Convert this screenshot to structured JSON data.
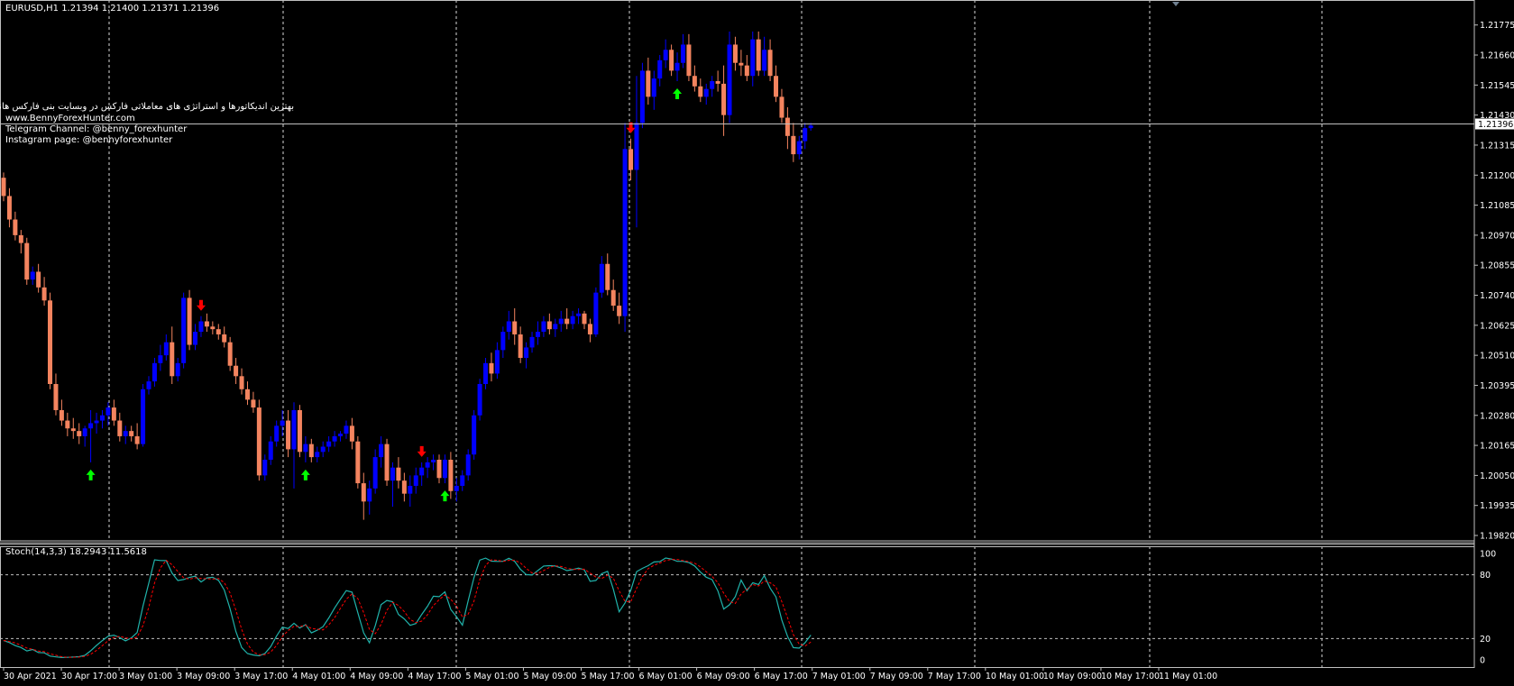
{
  "window": {
    "symbol_line": "EURUSD,H1  1.21394 1.21400 1.21371 1.21396"
  },
  "promo": {
    "line1": "بهترین اندیکاتورها و استراتژی های معاملاتی فارکس در وبسایت بنی فارکس هانتر",
    "line2": "www.BennyForexHunter.com",
    "line3": "Telegram Channel: @benny_forexhunter",
    "line4": "Instagram page: @bennyforexhunter"
  },
  "colors": {
    "background": "#000000",
    "bull": "#0000ff",
    "bear": "#f4845f",
    "grid": "#ffffff",
    "up_arrow": "#00ff00",
    "down_arrow": "#ff0000",
    "stoch_main": "#20b2aa",
    "stoch_signal": "#ff0000",
    "price_line": "#c0c0c0"
  },
  "price_axis": {
    "ticks": [
      "1.21775",
      "1.21660",
      "1.21545",
      "1.21430",
      "1.21315",
      "1.21200",
      "1.21085",
      "1.20970",
      "1.20855",
      "1.20740",
      "1.20625",
      "1.20510",
      "1.20395",
      "1.20280",
      "1.20165",
      "1.20050",
      "1.19935",
      "1.19820"
    ],
    "current_price": "1.21396"
  },
  "time_axis": {
    "labels": [
      "30 Apr 2021",
      "30 Apr 17:00",
      "3 May 01:00",
      "3 May 09:00",
      "3 May 17:00",
      "4 May 01:00",
      "4 May 09:00",
      "4 May 17:00",
      "5 May 01:00",
      "5 May 09:00",
      "5 May 17:00",
      "6 May 01:00",
      "6 May 09:00",
      "6 May 17:00",
      "7 May 01:00",
      "7 May 09:00",
      "7 May 17:00",
      "10 May 01:00",
      "10 May 09:00",
      "10 May 17:00",
      "11 May 01:00"
    ]
  },
  "stoch": {
    "label": "Stoch(14,3,3) 18.2943 11.5618",
    "levels": [
      "100",
      "80",
      "20",
      "0"
    ]
  },
  "chart_data": {
    "type": "candlestick",
    "symbol": "EURUSD",
    "timeframe": "H1",
    "ylim": [
      1.1982,
      1.2185
    ],
    "candles_ohlc_approx": [
      [
        1.2119,
        1.2121,
        1.211,
        1.2112
      ],
      [
        1.2112,
        1.2115,
        1.21,
        1.2103
      ],
      [
        1.2103,
        1.2106,
        1.2095,
        1.2097
      ],
      [
        1.2097,
        1.2099,
        1.209,
        1.2094
      ],
      [
        1.2094,
        1.2096,
        1.2078,
        1.208
      ],
      [
        1.208,
        1.2085,
        1.2078,
        1.2083
      ],
      [
        1.2083,
        1.2086,
        1.2075,
        1.2077
      ],
      [
        1.2077,
        1.2081,
        1.207,
        1.2072
      ],
      [
        1.2072,
        1.2075,
        1.2038,
        1.204
      ],
      [
        1.204,
        1.2044,
        1.2028,
        1.203
      ],
      [
        1.203,
        1.2034,
        1.2024,
        1.2026
      ],
      [
        1.2026,
        1.2029,
        1.202,
        1.2023
      ],
      [
        1.2023,
        1.2027,
        1.2019,
        1.2022
      ],
      [
        1.2022,
        1.2025,
        1.2017,
        1.202
      ],
      [
        1.202,
        1.2024,
        1.2016,
        1.2023
      ],
      [
        1.2023,
        1.203,
        1.201,
        1.2025
      ],
      [
        1.2025,
        1.2029,
        1.2021,
        1.2026
      ],
      [
        1.2026,
        1.203,
        1.2023,
        1.2028
      ],
      [
        1.2028,
        1.2033,
        1.2024,
        1.2031
      ],
      [
        1.2031,
        1.2034,
        1.2024,
        1.2026
      ],
      [
        1.2026,
        1.2029,
        1.2018,
        1.202
      ],
      [
        1.202,
        1.2024,
        1.2017,
        1.2022
      ],
      [
        1.2022,
        1.2024,
        1.2018,
        1.202
      ],
      [
        1.202,
        1.2025,
        1.2015,
        1.2017
      ],
      [
        1.2017,
        1.204,
        1.2016,
        1.2038
      ],
      [
        1.2038,
        1.2043,
        1.2036,
        1.2041
      ],
      [
        1.2041,
        1.205,
        1.2039,
        1.2048
      ],
      [
        1.2048,
        1.2055,
        1.2045,
        1.2051
      ],
      [
        1.2051,
        1.2059,
        1.2049,
        1.2056
      ],
      [
        1.2056,
        1.2062,
        1.204,
        1.2043
      ],
      [
        1.2043,
        1.205,
        1.2041,
        1.2048
      ],
      [
        1.2048,
        1.2075,
        1.2046,
        1.2073
      ],
      [
        1.2073,
        1.2076,
        1.2053,
        1.2055
      ],
      [
        1.2055,
        1.2063,
        1.2053,
        1.206
      ],
      [
        1.206,
        1.2066,
        1.2058,
        1.2064
      ],
      [
        1.2064,
        1.2067,
        1.206,
        1.2062
      ],
      [
        1.2062,
        1.2064,
        1.2059,
        1.2061
      ],
      [
        1.2061,
        1.2063,
        1.2057,
        1.2059
      ],
      [
        1.2059,
        1.2062,
        1.2054,
        1.2056
      ],
      [
        1.2056,
        1.2058,
        1.2045,
        1.2047
      ],
      [
        1.2047,
        1.205,
        1.204,
        1.2043
      ],
      [
        1.2043,
        1.2046,
        1.2036,
        1.2038
      ],
      [
        1.2038,
        1.2041,
        1.2032,
        1.2034
      ],
      [
        1.2034,
        1.2037,
        1.2029,
        1.2031
      ],
      [
        1.2031,
        1.2034,
        1.2003,
        1.2005
      ],
      [
        1.2005,
        1.2013,
        1.2003,
        1.2011
      ],
      [
        1.2011,
        1.202,
        1.2009,
        1.2018
      ],
      [
        1.2018,
        1.2026,
        1.2016,
        1.2024
      ],
      [
        1.2024,
        1.203,
        1.202,
        1.2026
      ],
      [
        1.2026,
        1.203,
        1.2012,
        1.2015
      ],
      [
        1.2015,
        1.2033,
        1.2,
        1.203
      ],
      [
        1.203,
        1.2032,
        1.2012,
        1.2014
      ],
      [
        1.2014,
        1.202,
        1.201,
        1.2017
      ],
      [
        1.2017,
        1.2019,
        1.201,
        1.2012
      ],
      [
        1.2012,
        1.2016,
        1.201,
        1.2014
      ],
      [
        1.2014,
        1.2018,
        1.2012,
        1.2016
      ],
      [
        1.2016,
        1.202,
        1.2014,
        1.2018
      ],
      [
        1.2018,
        1.2022,
        1.2016,
        1.202
      ],
      [
        1.202,
        1.2022,
        1.2018,
        1.2021
      ],
      [
        1.2021,
        1.2026,
        1.2019,
        1.2024
      ],
      [
        1.2024,
        1.2027,
        1.2015,
        1.2018
      ],
      [
        1.2018,
        1.202,
        1.2,
        1.2002
      ],
      [
        1.2002,
        1.2006,
        1.1988,
        1.1995
      ],
      [
        1.1995,
        1.2003,
        1.199,
        1.2
      ],
      [
        1.2,
        1.2015,
        1.1998,
        1.2012
      ],
      [
        1.2012,
        1.202,
        1.2008,
        1.2017
      ],
      [
        1.2017,
        1.2019,
        1.2001,
        1.2003
      ],
      [
        1.2003,
        1.201,
        1.1993,
        1.2008
      ],
      [
        1.2008,
        1.2012,
        1.2,
        1.2003
      ],
      [
        1.2003,
        1.2006,
        1.1995,
        1.1998
      ],
      [
        1.1998,
        1.2005,
        1.1993,
        1.2001
      ],
      [
        1.2001,
        1.2008,
        1.1998,
        1.2005
      ],
      [
        1.2005,
        1.201,
        1.2001,
        1.2008
      ],
      [
        1.2008,
        1.2012,
        1.2004,
        1.201
      ],
      [
        1.201,
        1.2013,
        1.2007,
        1.2011
      ],
      [
        1.2011,
        1.2013,
        1.2002,
        1.2004
      ],
      [
        1.2004,
        1.2013,
        1.2002,
        1.2011
      ],
      [
        1.2011,
        1.2014,
        1.1996,
        1.1999
      ],
      [
        1.1999,
        1.2004,
        1.1995,
        1.2001
      ],
      [
        1.2001,
        1.2007,
        1.1999,
        1.2005
      ],
      [
        1.2005,
        1.2015,
        1.2003,
        1.2013
      ],
      [
        1.2013,
        1.203,
        1.2011,
        1.2028
      ],
      [
        1.2028,
        1.2042,
        1.2026,
        1.204
      ],
      [
        1.204,
        1.205,
        1.2038,
        1.2048
      ],
      [
        1.2048,
        1.2052,
        1.2041,
        1.2044
      ],
      [
        1.2044,
        1.2056,
        1.2042,
        1.2053
      ],
      [
        1.2053,
        1.2062,
        1.205,
        1.206
      ],
      [
        1.206,
        1.2068,
        1.2057,
        1.2064
      ],
      [
        1.2064,
        1.2069,
        1.2055,
        1.2059
      ],
      [
        1.2059,
        1.2062,
        1.2048,
        1.205
      ],
      [
        1.205,
        1.2056,
        1.2046,
        1.2054
      ],
      [
        1.2054,
        1.206,
        1.2052,
        1.2058
      ],
      [
        1.2058,
        1.2064,
        1.2055,
        1.206
      ],
      [
        1.206,
        1.2066,
        1.2058,
        1.2064
      ],
      [
        1.2064,
        1.2067,
        1.2059,
        1.2061
      ],
      [
        1.2061,
        1.2065,
        1.2058,
        1.2063
      ],
      [
        1.2063,
        1.2068,
        1.206,
        1.2065
      ],
      [
        1.2065,
        1.2069,
        1.2061,
        1.2063
      ],
      [
        1.2063,
        1.2068,
        1.2061,
        1.2066
      ],
      [
        1.2066,
        1.2069,
        1.2063,
        1.2067
      ],
      [
        1.2067,
        1.2068,
        1.2061,
        1.2063
      ],
      [
        1.2063,
        1.2065,
        1.2056,
        1.2059
      ],
      [
        1.2059,
        1.2077,
        1.2058,
        1.2075
      ],
      [
        1.2075,
        1.2089,
        1.2073,
        1.2086
      ],
      [
        1.2086,
        1.209,
        1.2074,
        1.2076
      ],
      [
        1.2076,
        1.208,
        1.2068,
        1.207
      ],
      [
        1.207,
        1.2075,
        1.2063,
        1.2066
      ],
      [
        1.2066,
        1.214,
        1.206,
        1.213
      ],
      [
        1.213,
        1.2134,
        1.2118,
        1.2122
      ],
      [
        1.2122,
        1.2158,
        1.21,
        1.214
      ],
      [
        1.214,
        1.2163,
        1.2138,
        1.216
      ],
      [
        1.216,
        1.2165,
        1.2147,
        1.215
      ],
      [
        1.215,
        1.216,
        1.2145,
        1.2157
      ],
      [
        1.2157,
        1.2166,
        1.2154,
        1.2164
      ],
      [
        1.2164,
        1.2172,
        1.2161,
        1.2168
      ],
      [
        1.2168,
        1.217,
        1.2158,
        1.216
      ],
      [
        1.216,
        1.2167,
        1.2156,
        1.2163
      ],
      [
        1.2163,
        1.2174,
        1.2161,
        1.217
      ],
      [
        1.217,
        1.2174,
        1.2156,
        1.2158
      ],
      [
        1.2158,
        1.2162,
        1.2152,
        1.2154
      ],
      [
        1.2154,
        1.2157,
        1.2148,
        1.215
      ],
      [
        1.215,
        1.2155,
        1.2147,
        1.2153
      ],
      [
        1.2153,
        1.2158,
        1.215,
        1.2156
      ],
      [
        1.2156,
        1.216,
        1.2152,
        1.2155
      ],
      [
        1.2155,
        1.2162,
        1.2135,
        1.2143
      ],
      [
        1.2143,
        1.2175,
        1.214,
        1.217
      ],
      [
        1.217,
        1.2173,
        1.216,
        1.2163
      ],
      [
        1.2163,
        1.2168,
        1.2158,
        1.2162
      ],
      [
        1.2162,
        1.2166,
        1.2156,
        1.2158
      ],
      [
        1.2158,
        1.2175,
        1.2154,
        1.2172
      ],
      [
        1.2172,
        1.2175,
        1.2158,
        1.216
      ],
      [
        1.216,
        1.2173,
        1.2158,
        1.2168
      ],
      [
        1.2168,
        1.2172,
        1.2156,
        1.2158
      ],
      [
        1.2158,
        1.2162,
        1.2148,
        1.215
      ],
      [
        1.215,
        1.2153,
        1.214,
        1.2142
      ],
      [
        1.2142,
        1.2146,
        1.213,
        1.2135
      ],
      [
        1.2135,
        1.214,
        1.2125,
        1.2128
      ],
      [
        1.2128,
        1.2135,
        1.2126,
        1.2133
      ],
      [
        1.2133,
        1.214,
        1.213,
        1.2138
      ],
      [
        1.2138,
        1.214,
        1.2137,
        1.2139
      ]
    ],
    "buy_arrows": [
      15,
      52,
      76,
      116,
      163,
      185
    ],
    "sell_arrows": [
      34,
      72,
      108,
      142,
      166
    ],
    "stochastic": {
      "k": 18.2943,
      "d": 11.5618,
      "levels": [
        20,
        80
      ]
    }
  }
}
